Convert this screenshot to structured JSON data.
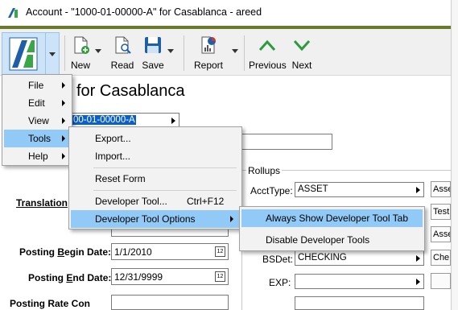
{
  "window": {
    "title": "Account - \"1000-01-00000-A\" for Casablanca - areed"
  },
  "toolbar": {
    "new_label": "New",
    "read_label": "Read",
    "save_label": "Save",
    "report_label": "Report",
    "previous_label": "Previous",
    "next_label": "Next"
  },
  "form": {
    "heading_suffix": "for Casablanca",
    "account_combo_value": "00-01-00000-A",
    "translation_label": "Translation",
    "posting_begin_label_pre": "Posting ",
    "posting_begin_label_u": "B",
    "posting_begin_label_post": "egin Date:",
    "posting_begin_value": "1/1/2010",
    "posting_end_label_pre": "Posting ",
    "posting_end_label_u": "E",
    "posting_end_label_post": "nd Date:",
    "posting_end_value": "12/31/9999",
    "posting_bottom_label": "Posting Rate Con",
    "cal_icon_text": "12"
  },
  "rollups": {
    "title": "Rollups",
    "acct_type_label": "AcctType:",
    "acct_type_value": "ASSET",
    "bsdet_label": "BSDet:",
    "bsdet_value": "CHECKING",
    "exp_label": "EXP:",
    "side_buttons": [
      "Asse",
      "Test",
      "Asse",
      "Che"
    ]
  },
  "main_menu": {
    "items": [
      {
        "label": "File",
        "has_submenu": true
      },
      {
        "label": "Edit",
        "has_submenu": true
      },
      {
        "label": "View",
        "has_submenu": true
      },
      {
        "label": "Tools",
        "has_submenu": true,
        "highlighted": true
      },
      {
        "label": "Help",
        "has_submenu": true
      }
    ]
  },
  "tools_menu": {
    "items": [
      {
        "label": "Export...",
        "shortcut": ""
      },
      {
        "label": "Import...",
        "shortcut": ""
      },
      {
        "label": "Reset Form",
        "shortcut": ""
      },
      {
        "label": "Developer Tool...",
        "shortcut": "Ctrl+F12"
      },
      {
        "label": "Developer Tool Options",
        "shortcut": "",
        "has_submenu": true,
        "highlighted": true
      }
    ]
  },
  "dev_options_menu": {
    "items": [
      {
        "label": "Always Show Developer Tool Tab",
        "highlighted": true
      },
      {
        "label": "Disable Developer Tools"
      }
    ]
  },
  "colors": {
    "accent_bar": "#6b7a2a",
    "menu_highlight": "#91c9f7",
    "logo_green": "#3aa64a",
    "logo_blue": "#1f5fa8",
    "nav_green": "#2e9a3e",
    "selection_blue": "#0a5fc8"
  }
}
